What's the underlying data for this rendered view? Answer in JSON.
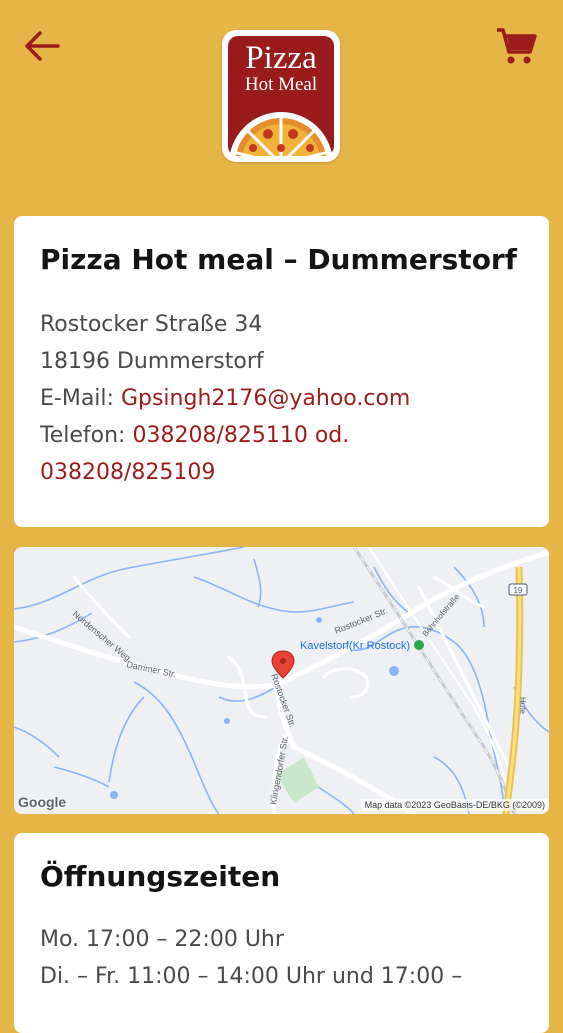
{
  "header": {
    "back_icon": "arrow-left-icon",
    "cart_icon": "shopping-cart-icon",
    "logo": {
      "line1": "Pizza",
      "line2": "Hot Meal"
    },
    "accent_color": "#9b1c1c"
  },
  "address_card": {
    "title": "Pizza Hot meal – Dummerstorf",
    "street": "Rostocker Straße 34",
    "city": "18196 Dummerstorf",
    "email_label": "E-Mail:",
    "email": "Gpsingh2176@yahoo.com",
    "phone_label": "Telefon:",
    "phone_1": "038208/825110 od.",
    "phone_2": "038208/825109"
  },
  "map": {
    "roads": [
      "Rostocker Str.",
      "Dammer Str.",
      "Nordenscher Weg",
      "Klingendorfer Str.",
      "Bahnhofstraße",
      "Hufe"
    ],
    "road_number": "19",
    "station": "Kavelstorf(Kr Rostock)",
    "google_label": "Google",
    "attribution": "Map data ©2023 GeoBasis-DE/BKG (©2009)"
  },
  "hours_card": {
    "title": "Öffnungszeiten",
    "lines": [
      "Mo. 17:00 – 22:00 Uhr",
      "Di. – Fr. 11:00 – 14:00 Uhr und 17:00 –"
    ]
  },
  "colors": {
    "background": "#e6b547",
    "card": "#ffffff",
    "link": "#9b1c1c"
  }
}
